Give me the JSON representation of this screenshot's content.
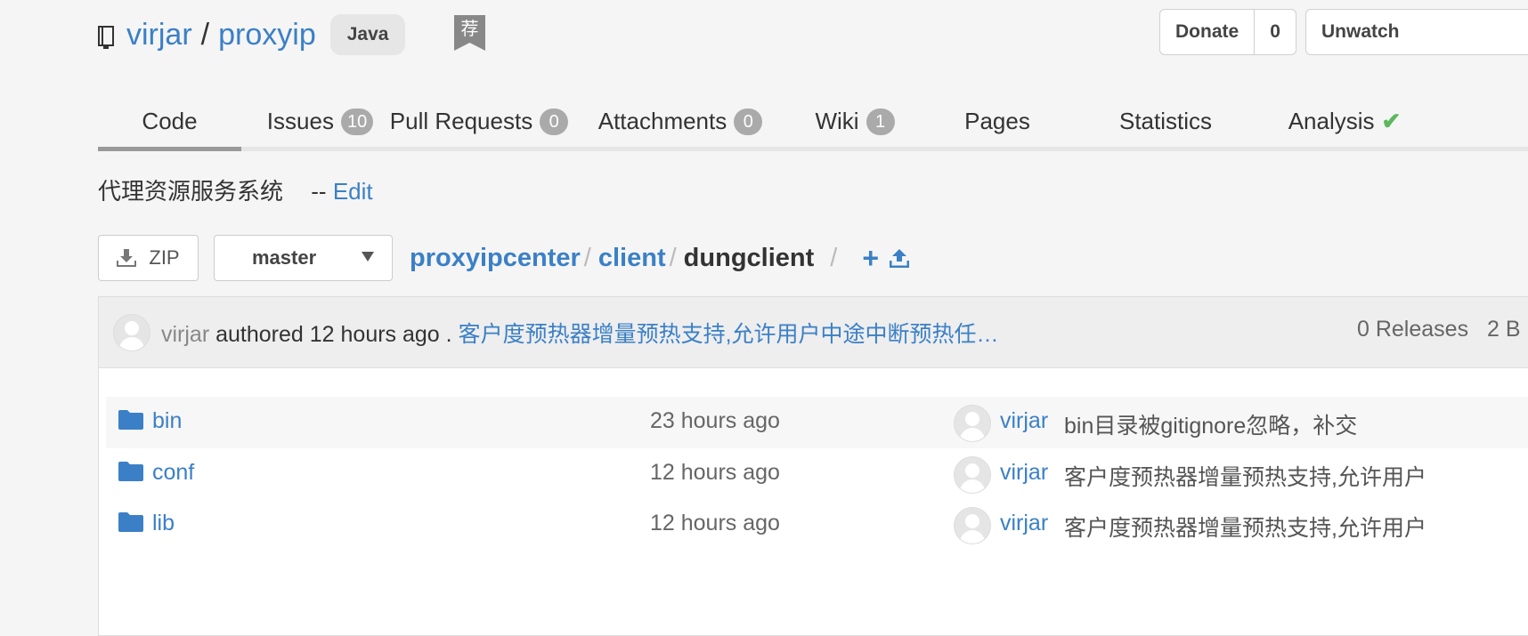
{
  "repo": {
    "owner": "virjar",
    "separator": "/",
    "name": "proxyip",
    "language": "Java",
    "recommend_badge": "荐"
  },
  "actions": {
    "donate_label": "Donate",
    "donate_count": "0",
    "unwatch_label": "Unwatch"
  },
  "tabs": [
    {
      "label": "Code",
      "count": null
    },
    {
      "label": "Issues",
      "count": "10"
    },
    {
      "label": "Pull Requests",
      "count": "0"
    },
    {
      "label": "Attachments",
      "count": "0"
    },
    {
      "label": "Wiki",
      "count": "1"
    },
    {
      "label": "Pages",
      "count": null
    },
    {
      "label": "Statistics",
      "count": null
    },
    {
      "label": "Analysis",
      "count": null
    }
  ],
  "description": {
    "text": "代理资源服务系统",
    "dash": "--",
    "edit_label": "Edit"
  },
  "toolbar": {
    "zip_label": "ZIP",
    "branch": "master"
  },
  "breadcrumb": {
    "items": [
      "proxyipcenter",
      "client"
    ],
    "current": "dungclient",
    "separator": "/"
  },
  "last_commit": {
    "author": "virjar",
    "authored_text": "authored 12 hours ago .",
    "message": "客户度预热器增量预热支持,允许用户中途中断预热任…",
    "releases": "0 Releases",
    "branches_partial": "2 B"
  },
  "parent_link": "...",
  "files": [
    {
      "name": "bin",
      "time": "23 hours ago",
      "user": "virjar",
      "message": "bin目录被gitignore忽略，补交"
    },
    {
      "name": "conf",
      "time": "12 hours ago",
      "user": "virjar",
      "message": "客户度预热器增量预热支持,允许用户"
    },
    {
      "name": "lib",
      "time": "12 hours ago",
      "user": "virjar",
      "message": "客户度预热器增量预热支持,允许用户"
    }
  ],
  "colors": {
    "link": "#3b80c6",
    "check": "#5cb85c",
    "count_badge": "#aaaaaa"
  }
}
